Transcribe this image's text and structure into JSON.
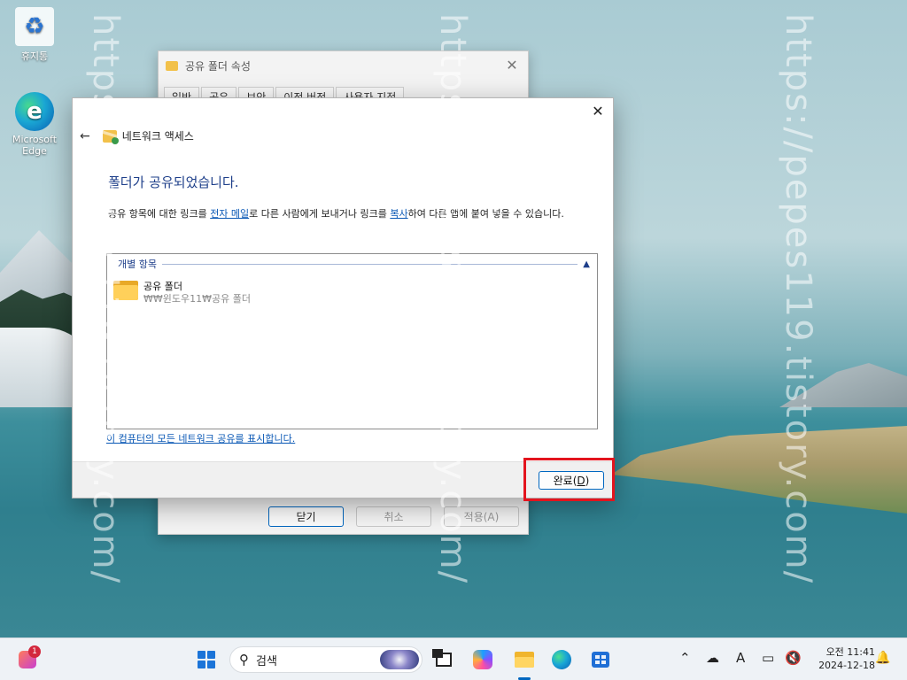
{
  "desktop": {
    "watermark_text": "https://pepes119.tistory.com/",
    "icons": [
      {
        "label": "휴지통"
      },
      {
        "label": "Microsoft Edge"
      }
    ]
  },
  "props_window": {
    "title": "공유 폴더 속성",
    "tabs": [
      "일반",
      "공유",
      "보안",
      "이전 버전",
      "사용자 지정"
    ],
    "buttons": {
      "close": "닫기",
      "cancel": "취소",
      "apply": "적용(A)"
    }
  },
  "network_dialog": {
    "title": "네트워크 액세스",
    "heading": "폴더가 공유되었습니다.",
    "desc_part1": "공유 항목에 대한 링크를 ",
    "desc_link1": "전자 메일",
    "desc_part2": "로 다른 사람에게 보내거나 링크를 ",
    "desc_link2": "복사",
    "desc_part3": "하여 다른 앱에 붙여 넣을 수 있습니다.",
    "group_label": "개별 항목",
    "item_name": "공유 폴더",
    "item_path": "₩₩윈도우11₩공유 폴더",
    "show_all_link": "이 컴퓨터의 모든 네트워크 공유를 표시합니다.",
    "done_label": "완료(",
    "done_accel": "D",
    "done_close": ")"
  },
  "taskbar": {
    "widget_badge": "1",
    "search_placeholder": "검색",
    "ime_indicator": "A",
    "clock_time": "오전 11:41",
    "clock_date": "2024-12-18"
  },
  "colors": {
    "accent": "#0067c0",
    "heading": "#1e3f8a",
    "link": "#0a58b5",
    "highlight": "#e3141e"
  }
}
